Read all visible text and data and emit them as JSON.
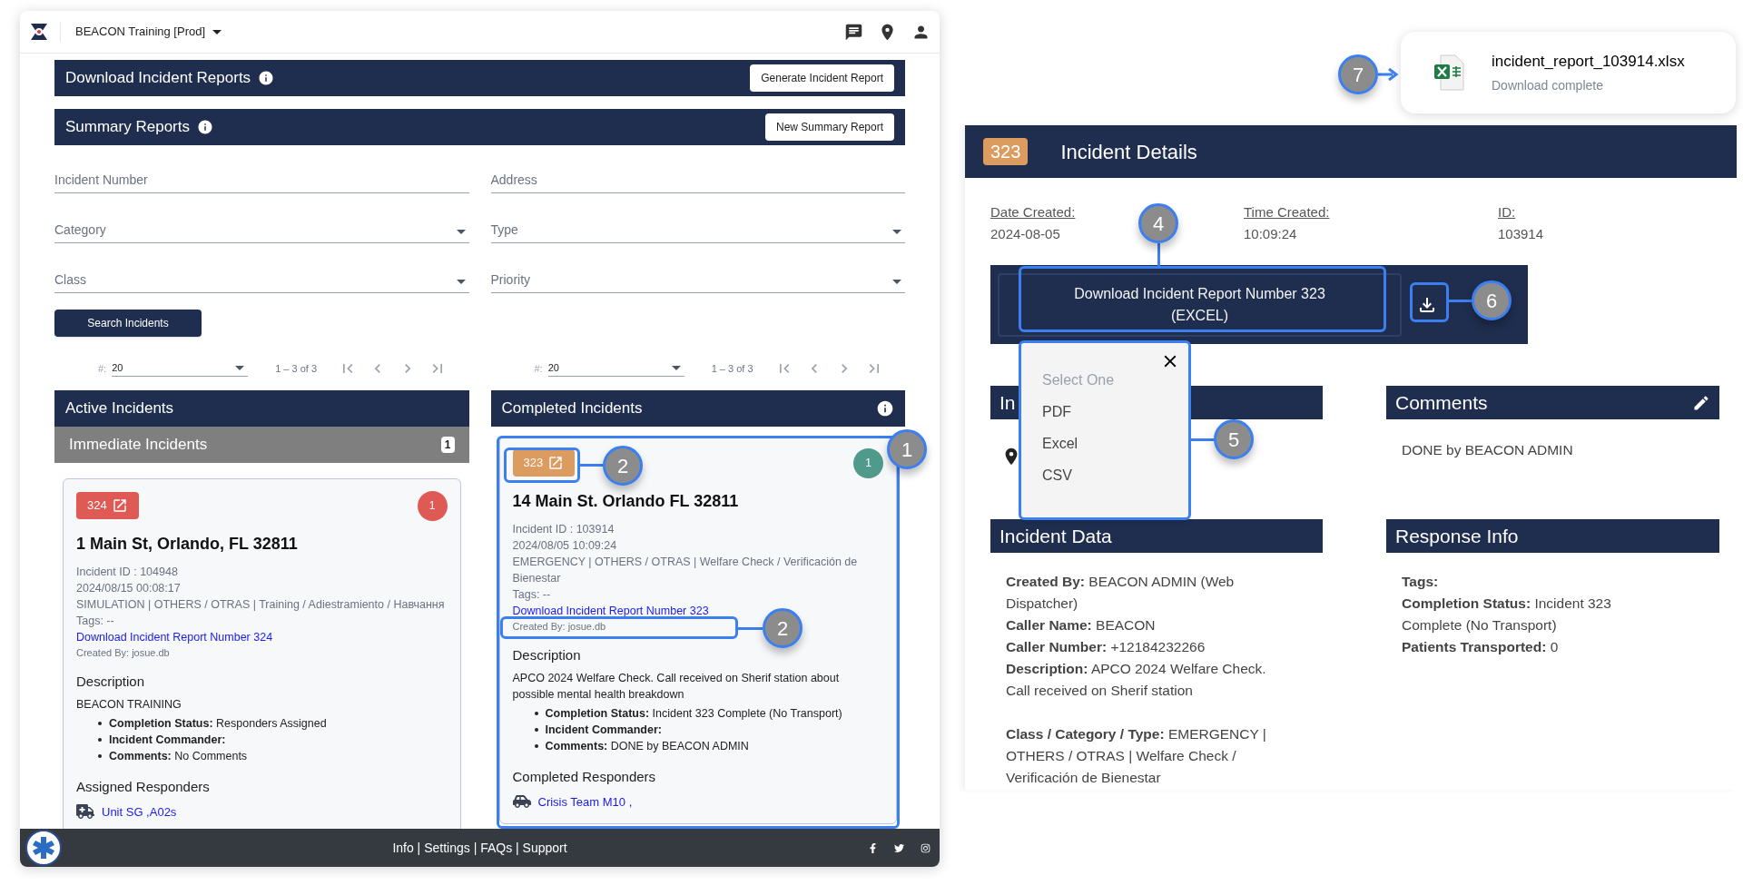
{
  "app": {
    "title": "BEACON Training [Prod]"
  },
  "banners": [
    {
      "title": "Download Incident Reports",
      "button": "Generate Incident Report"
    },
    {
      "title": "Summary Reports",
      "button": "New Summary Report"
    }
  ],
  "filters": [
    {
      "label": "Incident Number",
      "kind": "text"
    },
    {
      "label": "Address",
      "kind": "text"
    },
    {
      "label": "Category",
      "kind": "select"
    },
    {
      "label": "Type",
      "kind": "select"
    },
    {
      "label": "Class",
      "kind": "select"
    },
    {
      "label": "Priority",
      "kind": "select"
    }
  ],
  "search_button": "Search Incidents",
  "columns": [
    {
      "pagination": {
        "label": "#:",
        "value": "20",
        "range": "1 – 3 of 3"
      },
      "title": "Active Incidents",
      "info": false,
      "group": {
        "title": "Immediate Incidents",
        "count": "1"
      },
      "card": {
        "number": "324",
        "color": "#e05a55",
        "count": {
          "text": "1",
          "color": "#e05a55"
        },
        "address": "1 Main St, Orlando, FL 32811",
        "details": [
          "Incident ID : 104948",
          "2024/08/15 00:08:17",
          "SIMULATION | OTHERS / OTRAS | Training / Adiestramiento / Навчання",
          "Tags: --"
        ],
        "link": "Download Incident Report Number 324",
        "created_by": "Created By: josue.db",
        "description_title": "Description",
        "description": "BEACON TRAINING",
        "bullets": [
          "**Completion Status:** Responders Assigned",
          "**Incident Commander:**",
          "**Comments:** No Comments"
        ],
        "responders_title": "Assigned Responders",
        "responder": {
          "kind": "ambulance",
          "name": "Unit SG ,A02s"
        }
      }
    },
    {
      "pagination": {
        "label": "#:",
        "value": "20",
        "range": "1 – 3 of 3"
      },
      "title": "Completed Incidents",
      "info": true,
      "card": {
        "number": "323",
        "color": "#dc9b5f",
        "count": {
          "text": "1",
          "color": "#4f9a8a"
        },
        "address": "14 Main St. Orlando FL 32811",
        "details": [
          "Incident ID : 103914",
          "2024/08/05 10:09:24",
          "EMERGENCY | OTHERS / OTRAS | Welfare Check / Verificación de Bienestar",
          "Tags: --"
        ],
        "link": "Download Incident Report Number 323",
        "created_by": "Created By: josue.db",
        "description_title": "Description",
        "description": "APCO 2024 Welfare Check. Call received on Sherif station about possible mental health breakdown",
        "bullets": [
          "**Completion Status:** Incident 323 Complete (No Transport)",
          "**Incident Commander:**",
          "**Comments:** DONE by BEACON ADMIN"
        ],
        "responders_title": "Completed Responders",
        "responder": {
          "kind": "car",
          "name": "Crisis Team M10 ,"
        }
      }
    }
  ],
  "footer": {
    "links": "Info | Settings | FAQs | Support"
  },
  "details": {
    "number": "323",
    "title": "Incident Details",
    "fields": [
      {
        "label": "Date Created:",
        "value": "2024-08-05"
      },
      {
        "label": "Time Created:",
        "value": "10:09:24"
      },
      {
        "label": "ID:",
        "value": "103914"
      }
    ],
    "download_button": "Download Incident Report Number 323 (EXCEL)",
    "menu": {
      "prompt": "Select One",
      "options": [
        "PDF",
        "Excel",
        "CSV"
      ]
    },
    "location_title": "In",
    "comments_title": "Comments",
    "comments": "DONE by BEACON ADMIN",
    "data_title": "Incident Data",
    "data_groups": [
      [
        "**Created By:** BEACON ADMIN (Web Dispatcher)",
        "**Caller Name:** BEACON",
        "**Caller Number:** +12184232266",
        "**Description:** APCO 2024 Welfare Check. Call received on Sherif station"
      ],
      [
        "**Class / Category / Type:** EMERGENCY  |  OTHERS / OTRAS  |  Welfare Check / Verificación de Bienestar"
      ]
    ],
    "response_title": "Response Info",
    "response_lines": [
      "**Tags:**",
      "**Completion Status:** Incident 323 Complete (No Transport)",
      "**Patients Transported:** 0"
    ]
  },
  "toast": {
    "filename": "incident_report_103914.xlsx",
    "status": "Download complete"
  },
  "callouts": [
    "1",
    "2",
    "2",
    "4",
    "5",
    "6",
    "7"
  ]
}
